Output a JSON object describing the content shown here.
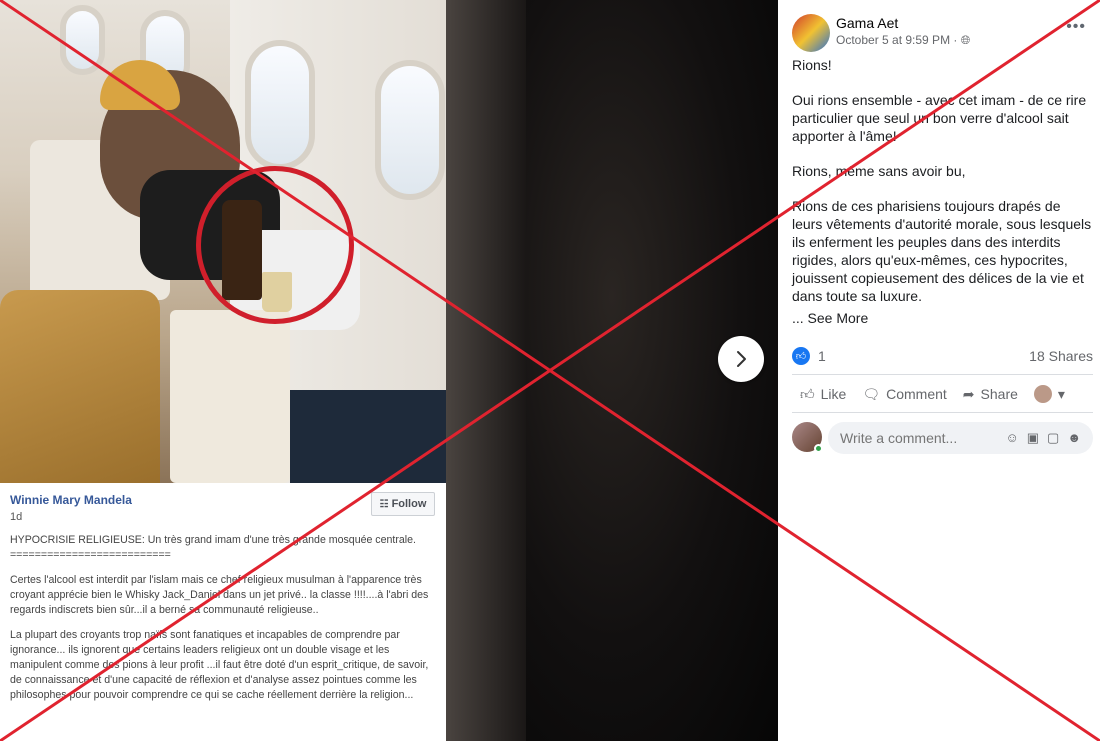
{
  "left_post": {
    "author": "Winnie Mary Mandela",
    "age": "1d",
    "follow_label": "Follow",
    "paragraphs": [
      "HYPOCRISIE RELIGIEUSE: Un très grand imam d'une très grande mosquée centrale.\n==========================",
      "Certes l'alcool est interdit par l'islam mais ce chef religieux musulman à l'apparence très croyant apprécie bien le Whisky Jack_Daniel dans un jet privé.. la classe !!!!....à l'abri des regards indiscrets bien sûr...il a berné sa communauté religieuse..",
      "La plupart des croyants trop naïfs sont fanatiques et incapables de comprendre par ignorance... ils ignorent que certains leaders religieux ont un double visage et les manipulent comme des pions à leur profit ...il faut être doté d'un esprit_critique, de savoir, de connaissance et d'une capacité de réflexion et d'analyse assez pointues comme les philosophes pour pouvoir comprendre ce qui se cache réellement derrière la religion..."
    ]
  },
  "right_post": {
    "name": "Gama Aet",
    "date": "October 5 at 9:59 PM · ",
    "more_label": "•••",
    "paragraphs": [
      "Rions!",
      "Oui rions ensemble - avec cet imam - de ce rire particulier que seul un bon verre d'alcool sait apporter à l'âme!",
      "Rions, même sans avoir bu,",
      "Rions de ces pharisiens toujours drapés de leurs vêtements d'autorité morale, sous lesquels ils enferment les peuples dans des interdits rigides, alors qu'eux-mêmes, ces hypocrites, jouissent copieusement des délices de la vie et dans toute sa luxure."
    ],
    "see_more": "... See More",
    "like_count": "1",
    "shares": "18 Shares",
    "actions": {
      "like": "Like",
      "comment": "Comment",
      "share": "Share"
    },
    "comment_placeholder": "Write a comment..."
  },
  "colors": {
    "x_overlay": "#e0232f",
    "link_blue": "#365899",
    "fb_blue": "#1877f2"
  }
}
